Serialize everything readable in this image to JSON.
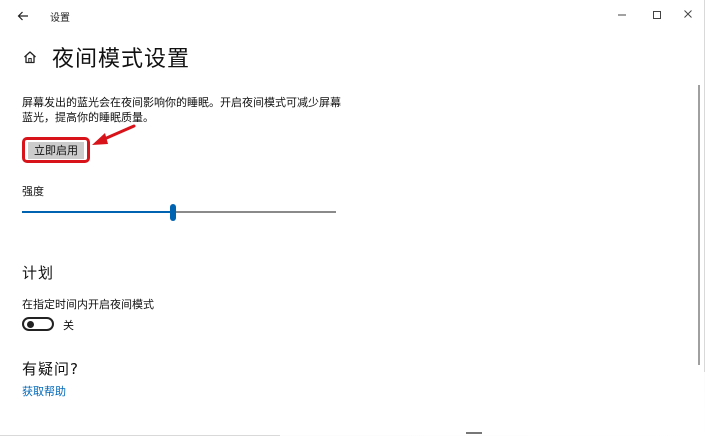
{
  "titlebar": {
    "back_icon": "back-arrow-icon",
    "app_title": "设置",
    "minimize_icon": "minimize-icon",
    "maximize_icon": "maximize-icon",
    "close_icon": "close-icon"
  },
  "header": {
    "home_icon": "home-icon",
    "title": "夜间模式设置"
  },
  "description": "屏幕发出的蓝光会在夜间影响你的睡眠。开启夜间模式可减少屏幕蓝光，提高你的睡眠质量。",
  "enable_button": {
    "label": "立即启用"
  },
  "strength": {
    "label": "强度",
    "value_fraction": 0.48
  },
  "schedule": {
    "heading": "计划",
    "label": "在指定时间内开启夜间模式",
    "toggle_state": "关",
    "toggle_on": false
  },
  "help": {
    "heading": "有疑问?",
    "link": "获取帮助"
  },
  "colors": {
    "accent": "#0063b1",
    "link": "#0067b8",
    "annotation_red": "#d8141a"
  }
}
